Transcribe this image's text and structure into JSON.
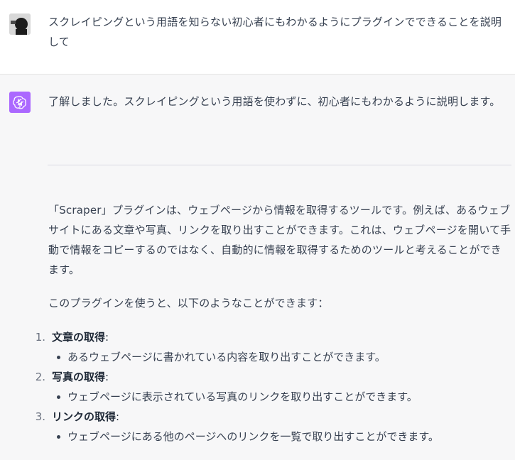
{
  "user": {
    "message": "スクレイピングという用語を知らない初心者にもわかるようにプラグインでできることを説明して"
  },
  "assistant": {
    "intro": "了解しました。スクレイピングという用語を使わずに、初心者にもわかるように説明します。",
    "paragraph1": "「Scraper」プラグインは、ウェブページから情報を取得するツールです。例えば、あるウェブサイトにある文章や写真、リンクを取り出すことができます。これは、ウェブページを開いて手動で情報をコピーするのではなく、自動的に情報を取得するためのツールと考えることができます。",
    "paragraph2": "このプラグインを使うと、以下のようなことができます：",
    "list": [
      {
        "num": "1.",
        "title": "文章の取得",
        "colon": ":",
        "detail": "あるウェブページに書かれている内容を取り出すことができます。"
      },
      {
        "num": "2.",
        "title": "写真の取得",
        "colon": ":",
        "detail": "ウェブページに表示されている写真のリンクを取り出すことができます。"
      },
      {
        "num": "3.",
        "title": "リンクの取得",
        "colon": ":",
        "detail": "ウェブページにある他のページへのリンクを一覧で取り出すことができます。"
      }
    ]
  },
  "colors": {
    "assistant_bg": "#f7f7f8",
    "bot_avatar_bg": "#ab68ff",
    "text": "#374151"
  },
  "icons": {
    "user_avatar": "user-avatar-photo",
    "bot_avatar": "openai-logo-icon"
  }
}
